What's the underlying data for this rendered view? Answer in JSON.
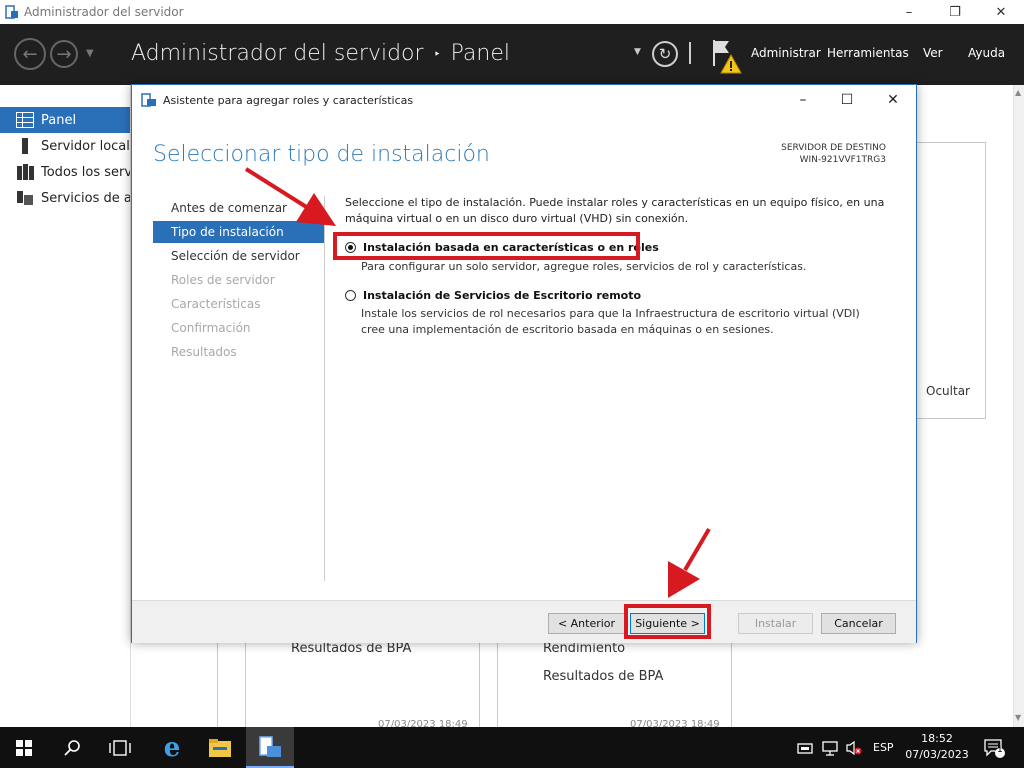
{
  "window": {
    "title": "Administrador del servidor"
  },
  "header": {
    "title": "Administrador del servidor",
    "separator": "‣",
    "current": "Panel",
    "menu": [
      "Administrar",
      "Herramientas",
      "Ver",
      "Ayuda"
    ]
  },
  "sidebar": {
    "items": [
      {
        "label": "Panel",
        "icon": "dashboard-icon"
      },
      {
        "label": "Servidor local",
        "icon": "local-server-icon"
      },
      {
        "label": "Todos los servidores",
        "icon": "all-servers-icon"
      },
      {
        "label": "Servicios de archivos y de almacenamiento",
        "icon": "file-services-icon"
      }
    ]
  },
  "background": {
    "hide_label": "Ocultar",
    "tile1": {
      "rows": [
        "Resultados de BPA"
      ],
      "date": "07/03/2023 18:49"
    },
    "tile2": {
      "rows": [
        "Rendimiento",
        "Resultados de BPA"
      ],
      "date": "07/03/2023 18:49"
    }
  },
  "dialog": {
    "title": "Asistente para agregar roles y características",
    "heading": "Seleccionar tipo de instalación",
    "dest_label": "SERVIDOR DE DESTINO",
    "dest_server": "WIN-921VVF1TRG3",
    "steps": [
      {
        "label": "Antes de comenzar",
        "state": "normal"
      },
      {
        "label": "Tipo de instalación",
        "state": "active"
      },
      {
        "label": "Selección de servidor",
        "state": "normal"
      },
      {
        "label": "Roles de servidor",
        "state": "disabled"
      },
      {
        "label": "Características",
        "state": "disabled"
      },
      {
        "label": "Confirmación",
        "state": "disabled"
      },
      {
        "label": "Resultados",
        "state": "disabled"
      }
    ],
    "description": "Seleccione el tipo de instalación. Puede instalar roles y características en un equipo físico, en una máquina virtual o en un disco duro virtual (VHD) sin conexión.",
    "options": [
      {
        "label": "Instalación basada en características o en roles",
        "description": "Para configurar un solo servidor, agregue roles, servicios de rol y características.",
        "selected": true
      },
      {
        "label": "Instalación de Servicios de Escritorio remoto",
        "description": "Instale los servicios de rol necesarios para que la Infraestructura de escritorio virtual (VDI) cree una implementación de escritorio basada en máquinas o en sesiones.",
        "selected": false
      }
    ],
    "buttons": {
      "previous": "< Anterior",
      "next": "Siguiente >",
      "install": "Instalar",
      "cancel": "Cancelar"
    }
  },
  "taskbar": {
    "language": "ESP",
    "time": "18:52",
    "date": "07/03/2023",
    "notification_count": "1"
  },
  "colors": {
    "accent": "#2a70b8",
    "heading": "#2d7ab8",
    "highlight_red": "#d71920",
    "header_bg": "#1f1f1f",
    "taskbar_bg": "#101010"
  }
}
